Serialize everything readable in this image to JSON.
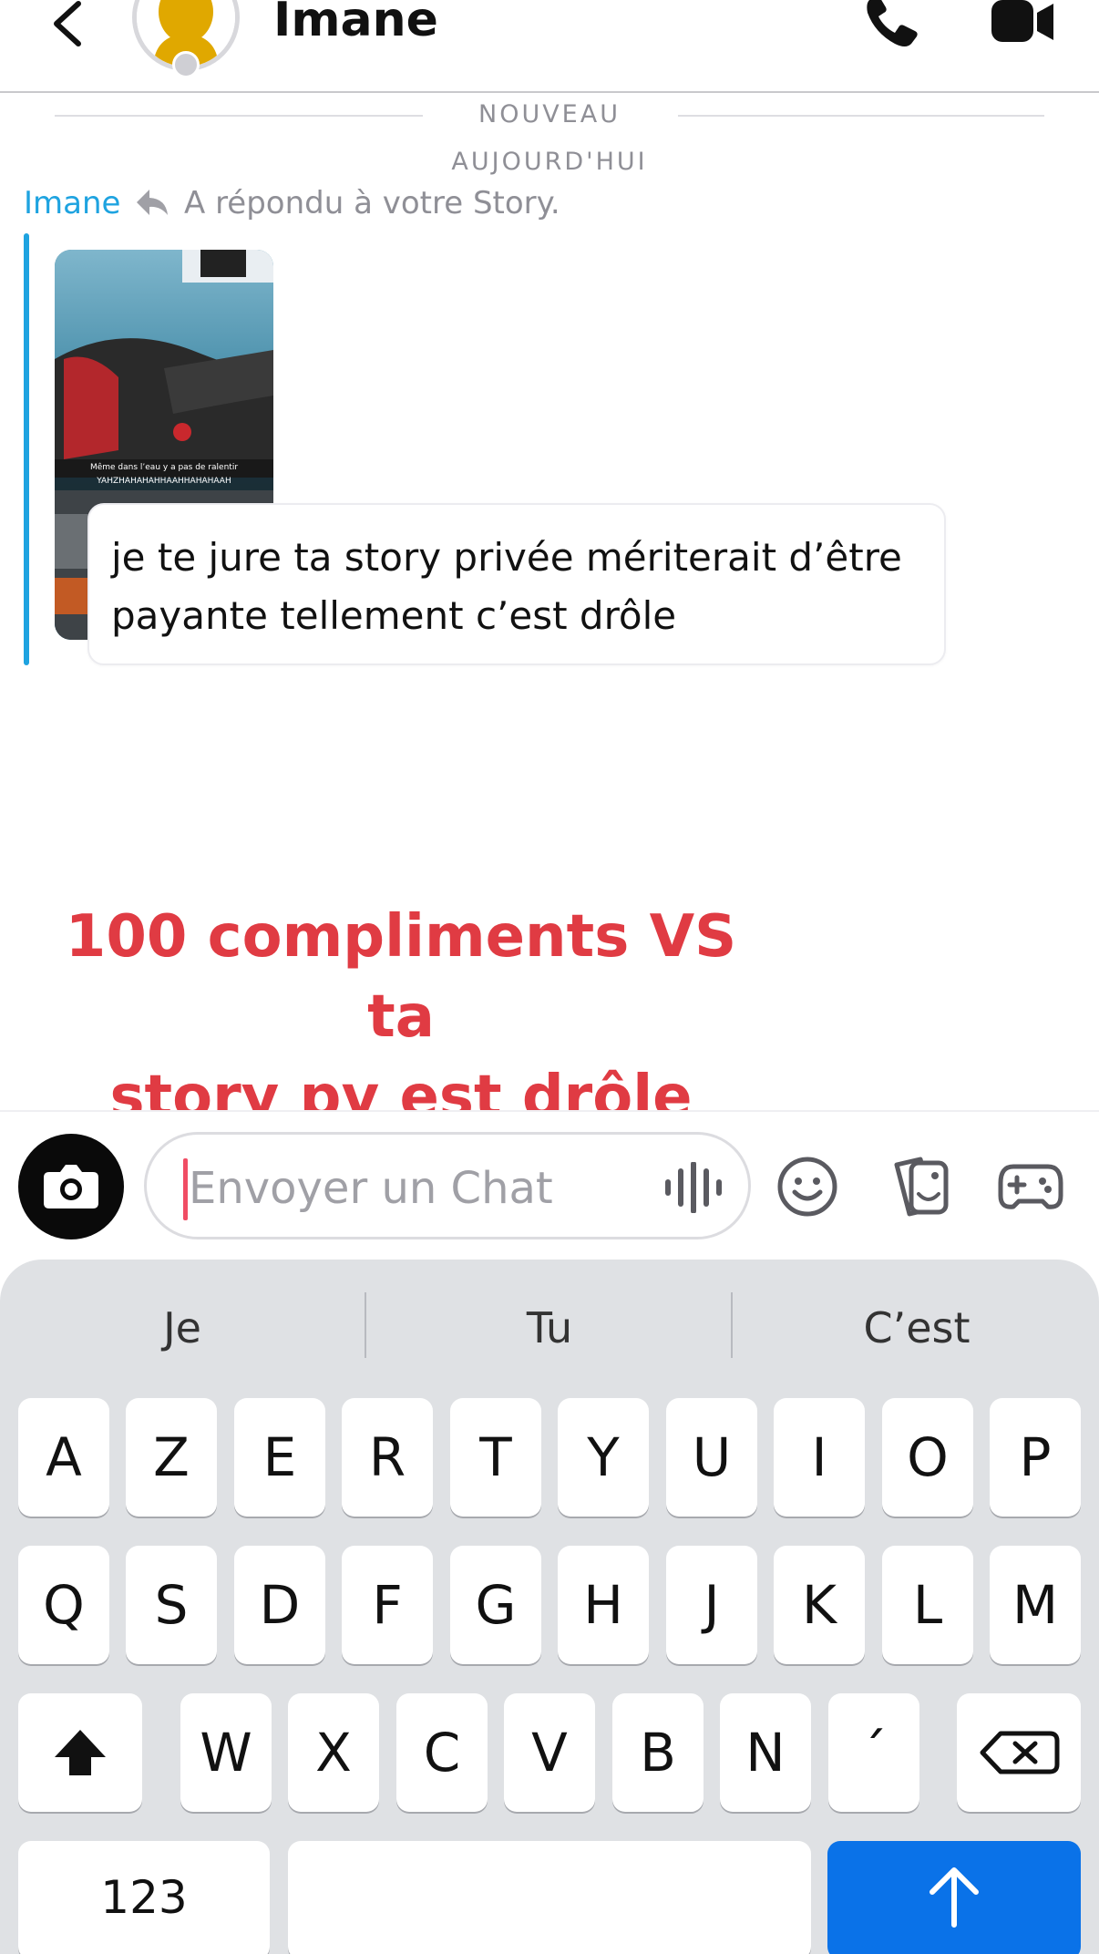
{
  "header": {
    "contact_name": "Imane"
  },
  "dividers": {
    "new": "NOUVEAU",
    "today": "AUJOURD'HUI"
  },
  "message": {
    "sender": "Imane",
    "reply_context": "A répondu à votre Story.",
    "story_caption_line1": "Même dans l’eau y a pas de ralentir",
    "story_caption_line2": "YAHZHAHAHAHHAAHHAHAHAAH",
    "text": "je te jure ta story privée mériterait d’être payante tellement c’est drôle"
  },
  "overlay": {
    "line1": "100 compliments VS ta",
    "line2": "story pv est drôle"
  },
  "input": {
    "placeholder": "Envoyer un Chat"
  },
  "keyboard": {
    "suggestions": [
      "Je",
      "Tu",
      "C’est"
    ],
    "row1": [
      "A",
      "Z",
      "E",
      "R",
      "T",
      "Y",
      "U",
      "I",
      "O",
      "P"
    ],
    "row2": [
      "Q",
      "S",
      "D",
      "F",
      "G",
      "H",
      "J",
      "K",
      "L",
      "M"
    ],
    "row3": [
      "W",
      "X",
      "C",
      "V",
      "B",
      "N",
      "´"
    ],
    "numbers_key": "123"
  },
  "icons": {
    "back": "chevron-left-icon",
    "call": "phone-icon",
    "video": "video-camera-icon",
    "reply": "reply-arrow-icon",
    "camera": "camera-icon",
    "voice": "microphone-waveform-icon",
    "emoji": "smiley-icon",
    "sticker": "sticker-icon",
    "game": "gamepad-icon",
    "shift": "shift-arrow-icon",
    "delete": "backspace-icon",
    "send": "up-arrow-icon"
  },
  "colors": {
    "accent_blue": "#1ea3e0",
    "overlay_red": "#e03b43",
    "send_key": "#0a72e8",
    "cursor": "#f04d64"
  }
}
